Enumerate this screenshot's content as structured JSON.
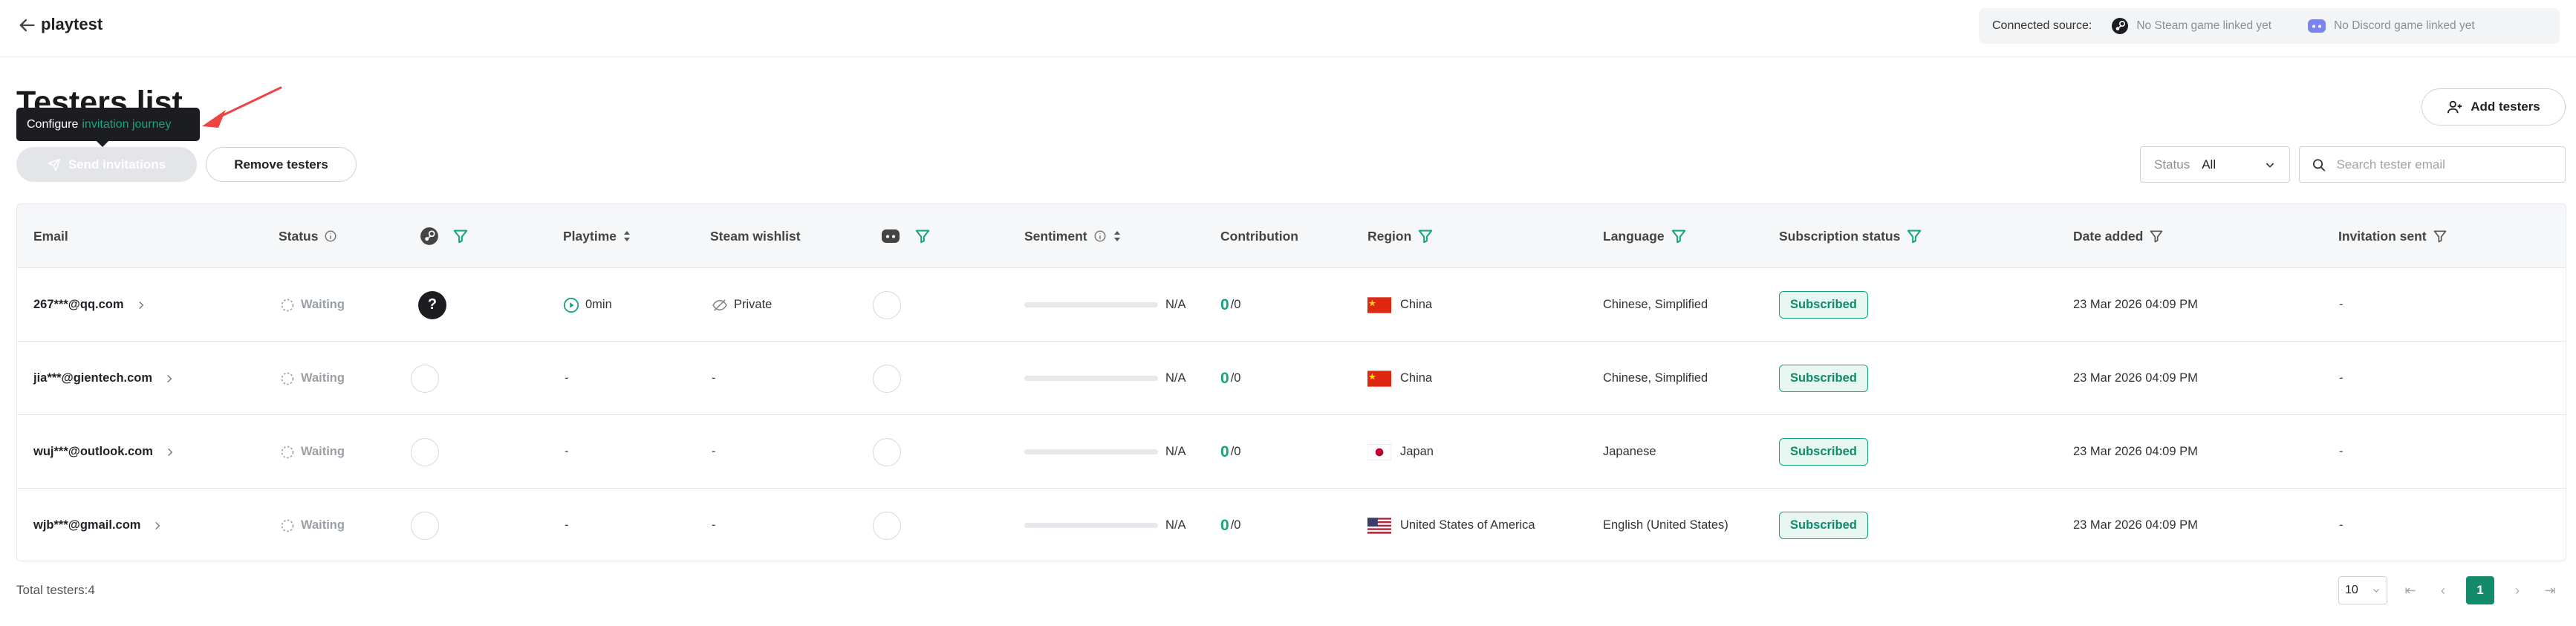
{
  "header": {
    "app_title": "playtest",
    "connected_label": "Connected source:",
    "steam_status": "No Steam game linked yet",
    "discord_status": "No Discord game linked yet"
  },
  "page": {
    "title": "Testers list",
    "tooltip_prefix": "Configure",
    "tooltip_link": "invitation journey"
  },
  "toolbar": {
    "send_label": "Send invitations",
    "remove_label": "Remove testers",
    "add_label": "Add testers",
    "status_label": "Status",
    "status_value": "All",
    "search_placeholder": "Search tester email"
  },
  "table": {
    "headers": {
      "email": "Email",
      "status": "Status",
      "playtime": "Playtime",
      "steam_wishlist": "Steam wishlist",
      "sentiment": "Sentiment",
      "contribution": "Contribution",
      "region": "Region",
      "language": "Language",
      "subscription": "Subscription status",
      "date_added": "Date added",
      "invitation_sent": "Invitation sent"
    },
    "rows": [
      {
        "email": "267***@qq.com",
        "status": "Waiting",
        "playtime": "0min",
        "wishlist": "Private",
        "sentiment": "N/A",
        "contrib_value": "0",
        "contrib_total": "/0",
        "region": "China",
        "language": "Chinese, Simplified",
        "subscription": "Subscribed",
        "date_added": "23 Mar 2026 04:09 PM",
        "invitation_sent": "-"
      },
      {
        "email": "jia***@gientech.com",
        "status": "Waiting",
        "playtime": "-",
        "wishlist": "-",
        "sentiment": "N/A",
        "contrib_value": "0",
        "contrib_total": "/0",
        "region": "China",
        "language": "Chinese, Simplified",
        "subscription": "Subscribed",
        "date_added": "23 Mar 2026 04:09 PM",
        "invitation_sent": "-"
      },
      {
        "email": "wuj***@outlook.com",
        "status": "Waiting",
        "playtime": "-",
        "wishlist": "-",
        "sentiment": "N/A",
        "contrib_value": "0",
        "contrib_total": "/0",
        "region": "Japan",
        "language": "Japanese",
        "subscription": "Subscribed",
        "date_added": "23 Mar 2026 04:09 PM",
        "invitation_sent": "-"
      },
      {
        "email": "wjb***@gmail.com",
        "status": "Waiting",
        "playtime": "-",
        "wishlist": "-",
        "sentiment": "N/A",
        "contrib_value": "0",
        "contrib_total": "/0",
        "region": "United States of America",
        "language": "English (United States)",
        "subscription": "Subscribed",
        "date_added": "23 Mar 2026 04:09 PM",
        "invitation_sent": "-"
      }
    ]
  },
  "footer": {
    "total_label": "Total testers:4",
    "page_size": "10",
    "current_page": "1"
  },
  "colors": {
    "accent": "#16a37f",
    "tooltip_bg": "#1c1d20",
    "annotation_arrow": "#ef4444"
  }
}
